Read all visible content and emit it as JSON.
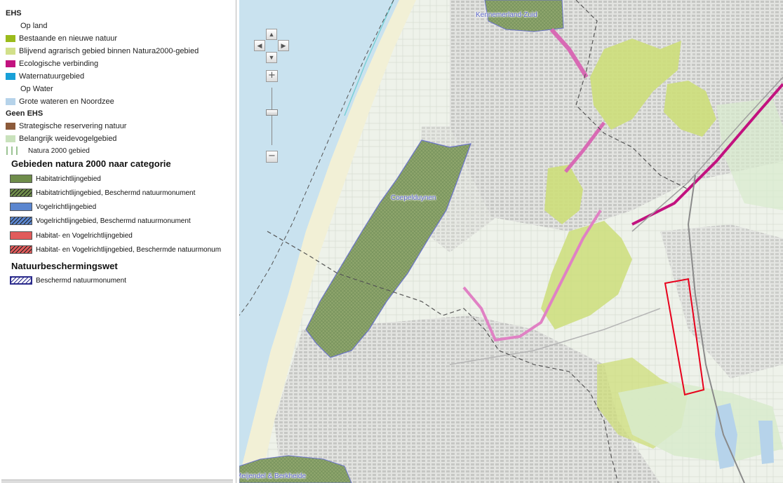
{
  "legend": {
    "ehs_header": "EHS",
    "op_land_label": "Op land",
    "ehs_land_items": [
      {
        "label": "Bestaande en nieuwe natuur",
        "color": "#9bbb1c"
      },
      {
        "label": "Blijvend agrarisch gebied binnen Natura2000-gebied",
        "color": "#d2e08a"
      },
      {
        "label": "Ecologische verbinding",
        "color": "#c2127f"
      },
      {
        "label": "Waternatuurgebied",
        "color": "#18a0d8"
      }
    ],
    "op_water_label": "Op Water",
    "ehs_water_items": [
      {
        "label": "Grote wateren en Noordzee",
        "color": "#b6d3ea"
      }
    ],
    "geen_ehs_header": "Geen EHS",
    "geen_ehs_items": [
      {
        "label": "Strategische reservering natuur",
        "color": "#8c5a3a"
      },
      {
        "label": "Belangrijk weidevogelgebied",
        "color": "#c9e2bc"
      }
    ],
    "natura_line_label": "Natura 2000 gebied",
    "natura_header": "Gebieden natura 2000 naar categorie",
    "natura_items": [
      {
        "label": "Habitatrichtlijngebied",
        "color": "#6e8c4a",
        "hatched": false
      },
      {
        "label": "Habitatrichtlijngebied, Beschermd natuurmonument",
        "color": "#6e8c4a",
        "hatched": true
      },
      {
        "label": "Vogelrichtlijngebied",
        "color": "#5b86cf",
        "hatched": false
      },
      {
        "label": "Vogelrichtlijngebied, Beschermd natuurmonument",
        "color": "#5b86cf",
        "hatched": true
      },
      {
        "label": "Habitat- en Vogelrichtlijngebied",
        "color": "#e15b5b",
        "hatched": false
      },
      {
        "label": "Habitat- en Vogelrichtlijngebied, Beschermde natuurmonum",
        "color": "#e15b5b",
        "hatched": true
      }
    ],
    "nbw_header": "Natuurbeschermingswet",
    "nbw_items": [
      {
        "label": "Beschermd natuurmonument",
        "color": "#2b2b8c"
      }
    ]
  },
  "map": {
    "place_labels": {
      "kennemerland": "Kennemerland-Zuid",
      "coepelduynen": "Coepelduynen",
      "meijendel": "Meijendel & Berkheide"
    },
    "controls": {
      "pan_up": "▲",
      "pan_left": "◀",
      "pan_right": "▶",
      "pan_down": "▼",
      "zoom_in": "+",
      "zoom_out": "−"
    },
    "colors": {
      "sea": "#c9e2ef",
      "beach": "#f2f0d6",
      "natura_dunes": "#8ea56c",
      "ehs_green": "#cdde7a",
      "ecological_link": "#d86ab4",
      "highlight": "#e8001c"
    }
  }
}
